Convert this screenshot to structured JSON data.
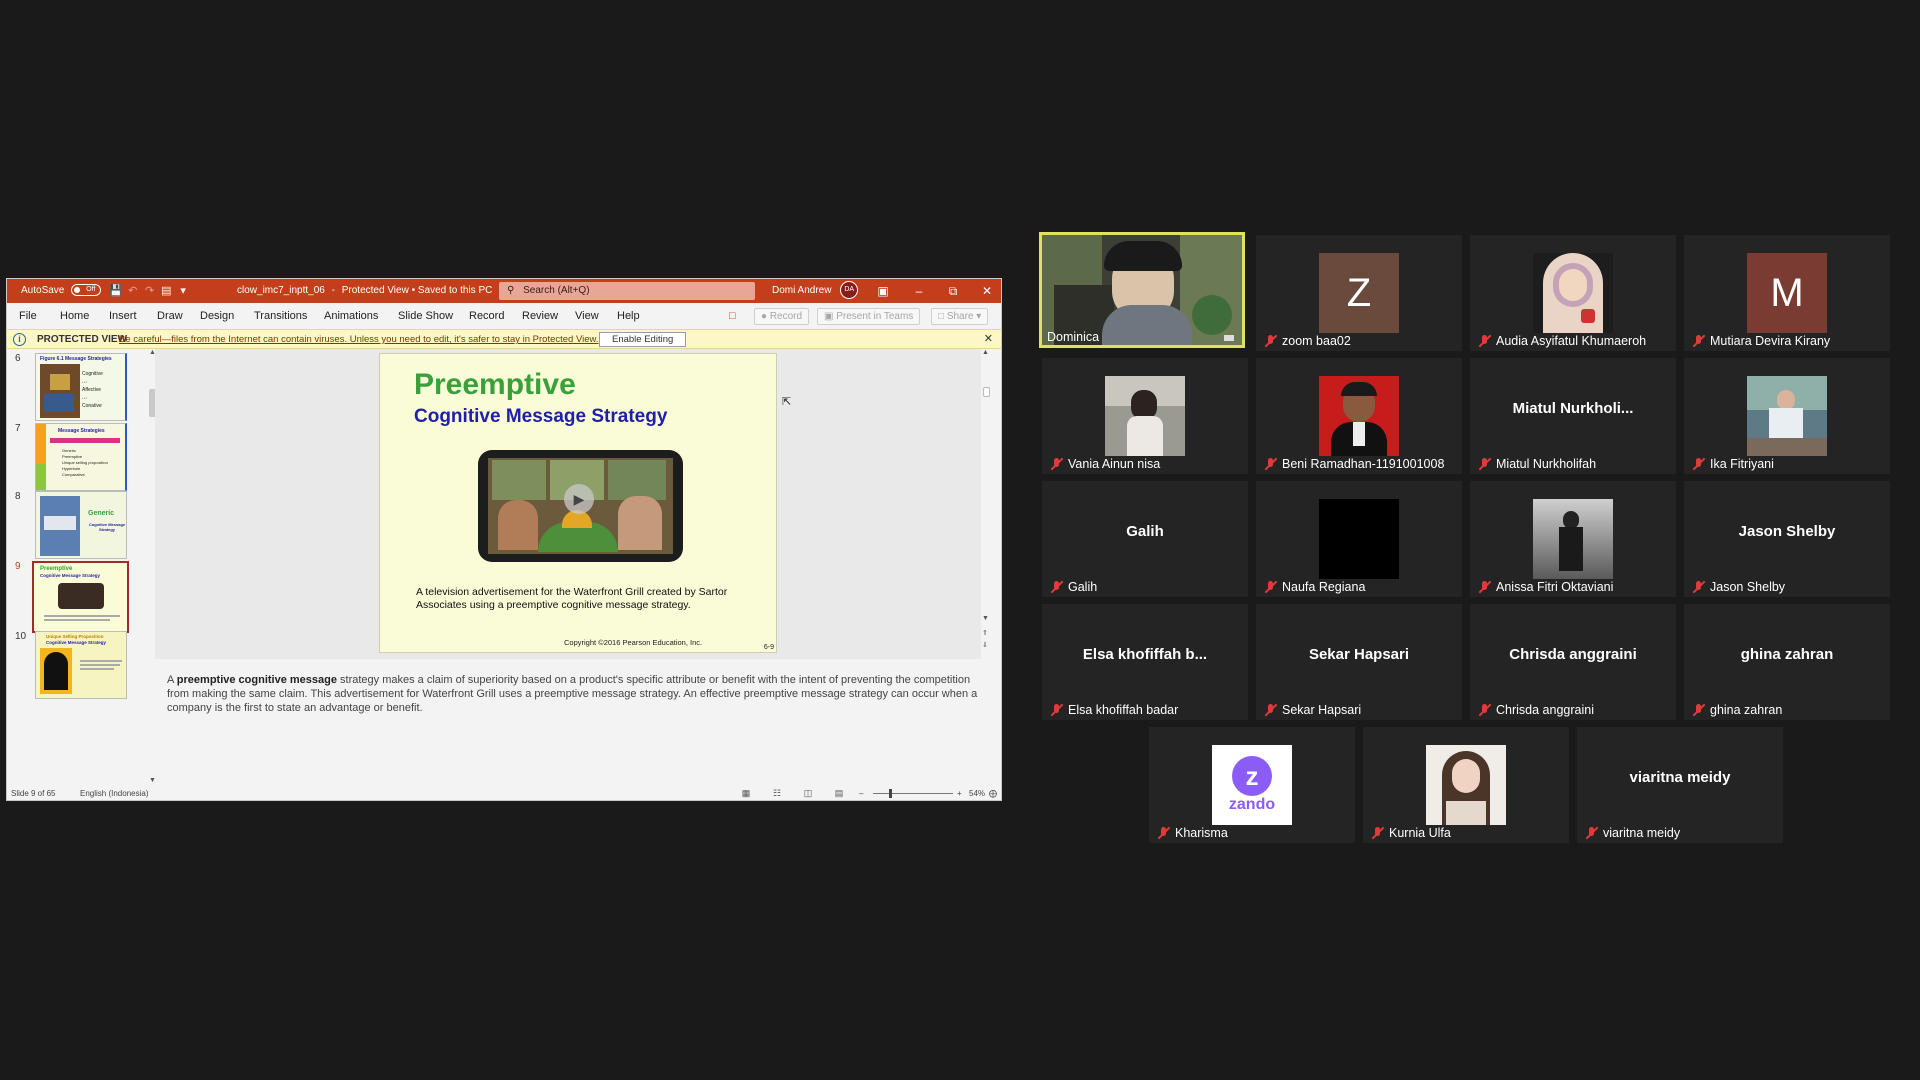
{
  "ppt": {
    "titlebar": {
      "autosave_label": "AutoSave",
      "autosave_state": "Off",
      "filename": "clow_imc7_inptt_06",
      "status": "Protected View • Saved to this PC",
      "search_placeholder": "Search (Alt+Q)",
      "user_name": "Domi Andrew",
      "user_initials": "DA"
    },
    "menu": [
      "File",
      "Home",
      "Insert",
      "Draw",
      "Design",
      "Transitions",
      "Animations",
      "Slide Show",
      "Record",
      "Review",
      "View",
      "Help"
    ],
    "buttons": {
      "record": "Record",
      "present_in_teams": "Present in Teams",
      "share": "Share"
    },
    "protected_view": {
      "title": "PROTECTED VIEW",
      "message": "Be careful—files from the Internet can contain viruses. Unless you need to edit, it's safer to stay in Protected View.",
      "button": "Enable Editing"
    },
    "thumbnails": [
      {
        "num": "6",
        "title": "Figure 6.1 Message Strategies",
        "bullets": [
          "Cognitive",
          "Affective",
          "Conative"
        ],
        "selected": false
      },
      {
        "num": "7",
        "title": "Message Strategies",
        "bullets": [
          "Generic",
          "Preemptive",
          "Unique selling proposition",
          "Hyperbole",
          "Comparative"
        ],
        "selected": false
      },
      {
        "num": "8",
        "title": "Generic",
        "subtitle": "Cognitive Message Strategy",
        "selected": false
      },
      {
        "num": "9",
        "title": "Preemptive",
        "subtitle": "Cognitive Message Strategy",
        "selected": true
      },
      {
        "num": "10",
        "title": "Unique Selling Proposition",
        "subtitle": "Cognitive Message Strategy",
        "selected": false
      }
    ],
    "slide": {
      "title": "Preemptive",
      "subtitle": "Cognitive Message Strategy",
      "caption": "A television advertisement for the Waterfront Grill created by Sartor Associates using a preemptive cognitive message strategy.",
      "copyright": "Copyright ©2016 Pearson Education, Inc.",
      "page_num": "6-9"
    },
    "notes": {
      "prefix": "A ",
      "bold": "preemptive cognitive message",
      "rest": " strategy makes a claim of superiority based on a product's specific attribute or benefit with the intent of preventing the competition from making the same claim. This advertisement for Waterfront Grill uses a preemptive message strategy. An effective preemptive message strategy can occur when a company is the first to state an advantage or benefit."
    },
    "status": {
      "slide_pos": "Slide 9 of 65",
      "language": "English (Indonesia)",
      "zoom": "54%"
    }
  },
  "participants": [
    {
      "name": "Dominica",
      "display": "video",
      "muted": false,
      "active": true
    },
    {
      "name": "zoom baa02",
      "display": "avatar",
      "letter": "Z",
      "color": "#6b4a3e",
      "muted": true
    },
    {
      "name": "Audia Asyifatul Khumaeroh",
      "display": "photo",
      "muted": true
    },
    {
      "name": "Mutiara Devira Kirany",
      "display": "avatar",
      "letter": "M",
      "color": "#7a3b33",
      "muted": true
    },
    {
      "name": "Vania Ainun nisa",
      "display": "photo",
      "muted": true
    },
    {
      "name": "Beni Ramadhan-1191001008",
      "display": "photo",
      "muted": true
    },
    {
      "name": "Miatul Nurkholifah",
      "display": "name",
      "center": "Miatul  Nurkholi...",
      "muted": true
    },
    {
      "name": "Ika Fitriyani",
      "display": "photo",
      "muted": true
    },
    {
      "name": "Galih",
      "display": "name",
      "center": "Galih",
      "muted": true
    },
    {
      "name": "Naufa Regiana",
      "display": "photo",
      "muted": true
    },
    {
      "name": "Anissa Fitri Oktaviani",
      "display": "photo",
      "muted": true
    },
    {
      "name": "Jason Shelby",
      "display": "name",
      "center": "Jason Shelby",
      "muted": true
    },
    {
      "name": "Elsa khofiffah badar",
      "display": "name",
      "center": "Elsa  khofiffah  b...",
      "muted": true
    },
    {
      "name": "Sekar Hapsari",
      "display": "name",
      "center": "Sekar Hapsari",
      "muted": true
    },
    {
      "name": "Chrisda anggraini",
      "display": "name",
      "center": "Chrisda anggraini",
      "muted": true
    },
    {
      "name": "ghina zahran",
      "display": "name",
      "center": "ghina zahran",
      "muted": true
    },
    {
      "name": "Kharisma",
      "display": "logo",
      "logo_text": "zando",
      "muted": true
    },
    {
      "name": "Kurnia Ulfa",
      "display": "photo",
      "muted": true
    },
    {
      "name": "viaritna meidy",
      "display": "name",
      "center": "viaritna meidy",
      "muted": true
    }
  ]
}
